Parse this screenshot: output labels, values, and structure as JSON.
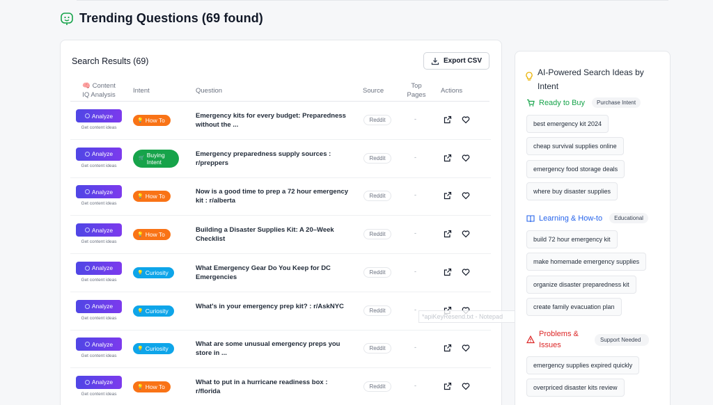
{
  "header": {
    "title": "Trending Questions (69 found)",
    "icon": "smile-icon",
    "accent": "#16a34a"
  },
  "results": {
    "title": "Search Results (69)",
    "export_label": "Export CSV",
    "columns": {
      "content_line1": "🧠 Content",
      "content_line2": "IQ Analysis",
      "intent": "Intent",
      "question": "Question",
      "source": "Source",
      "top_line1": "Top",
      "top_line2": "Pages",
      "actions": "Actions"
    },
    "rows": [
      {
        "analyze": "Analyze",
        "sub": "Get content ideas",
        "intent": "How To",
        "intent_type": "howto",
        "question": "Emergency kits for every budget: Preparedness without the ...",
        "source": "Reddit",
        "top": "-"
      },
      {
        "analyze": "Analyze",
        "sub": "Get content ideas",
        "intent": "Buying Intent",
        "intent_type": "buying",
        "question": "Emergency preparedness supply sources : r/preppers",
        "source": "Reddit",
        "top": "-"
      },
      {
        "analyze": "Analyze",
        "sub": "Get content ideas",
        "intent": "How To",
        "intent_type": "howto",
        "question": "Now is a good time to prep a 72 hour emergency kit : r/alberta",
        "source": "Reddit",
        "top": "-"
      },
      {
        "analyze": "Analyze",
        "sub": "Get content ideas",
        "intent": "How To",
        "intent_type": "howto",
        "question": "Building a Disaster Supplies Kit: A 20–Week Checklist",
        "source": "Reddit",
        "top": "-"
      },
      {
        "analyze": "Analyze",
        "sub": "Get content ideas",
        "intent": "Curiosity",
        "intent_type": "curiosity",
        "question": "What Emergency Gear Do You Keep for DC Emergencies",
        "source": "Reddit",
        "top": "-"
      },
      {
        "analyze": "Analyze",
        "sub": "Get content ideas",
        "intent": "Curiosity",
        "intent_type": "curiosity",
        "question": "What's in your emergency prep kit? : r/AskNYC",
        "source": "Reddit",
        "top": "-"
      },
      {
        "analyze": "Analyze",
        "sub": "Get content ideas",
        "intent": "Curiosity",
        "intent_type": "curiosity",
        "question": "What are some unusual emergency preps you store in ...",
        "source": "Reddit",
        "top": "-"
      },
      {
        "analyze": "Analyze",
        "sub": "Get content ideas",
        "intent": "How To",
        "intent_type": "howto",
        "question": "What to put in a hurricane readiness box : r/florida",
        "source": "Reddit",
        "top": "-"
      }
    ]
  },
  "tooltip": "*apiKeyResend.txt - Notepad",
  "ideas": {
    "title": "AI-Powered Search Ideas by Intent",
    "sections": [
      {
        "title": "Ready to Buy",
        "tag": "Purchase Intent",
        "color": "#16a34a",
        "icon": "cart-icon",
        "chips": [
          "best emergency kit 2024",
          "cheap survival supplies online",
          "emergency food storage deals",
          "where buy disaster supplies"
        ]
      },
      {
        "title": "Learning & How-to",
        "tag": "Educational",
        "color": "#2563eb",
        "icon": "book-icon",
        "chips": [
          "build 72 hour emergency kit",
          "make homemade emergency supplies",
          "organize disaster preparedness kit",
          "create family evacuation plan"
        ]
      },
      {
        "title": "Problems & Issues",
        "tag": "Support Needed",
        "color": "#dc2626",
        "icon": "warning-icon",
        "chips": [
          "emergency supplies expired quickly",
          "overpriced disaster kits review"
        ]
      }
    ]
  }
}
